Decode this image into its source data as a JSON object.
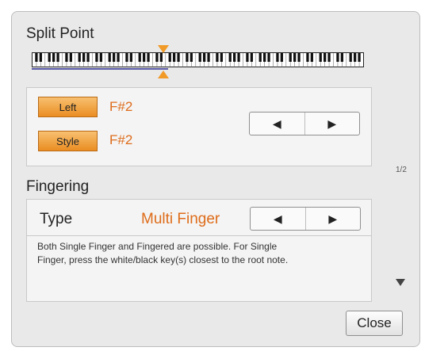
{
  "split_point": {
    "title": "Split Point",
    "keyboard_octaves": 11
  },
  "parts": [
    {
      "button_label": "Left",
      "value": "F#2"
    },
    {
      "button_label": "Style",
      "value": "F#2"
    }
  ],
  "arrows": {
    "left": "◀",
    "right": "▶"
  },
  "page_indicator": "1/2",
  "fingering": {
    "title": "Fingering",
    "type_label": "Type",
    "type_value": "Multi Finger",
    "description_line1": "Both Single Finger and Fingered are possible. For Single",
    "description_line2": "Finger, press the white/black key(s) closest to the root note."
  },
  "close_label": "Close",
  "colors": {
    "accent": "#de6c1a",
    "button_orange": "#f0a040",
    "marker": "#f19a28",
    "keyboard_line": "#5a5aa8"
  }
}
